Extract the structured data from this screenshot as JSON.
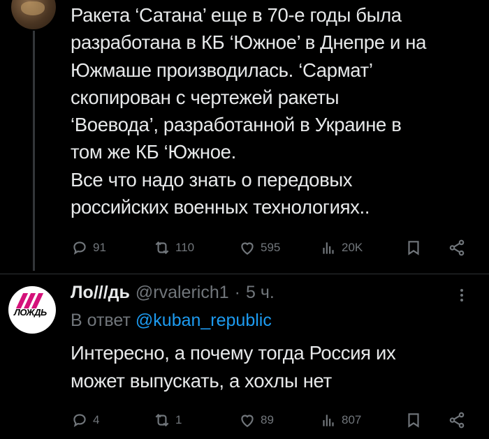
{
  "tweet1": {
    "text": "Ракета ‘Сатана’ еще в 70-е годы была\nразработана в КБ ‘Южное’ в Днепре и на\nЮжмаше производилась. ‘Сармат’\nскопирован с чертежей ракеты\n‘Воевода’, разработанной в Украине в\nтом же КБ ‘Южное.\nВсе что надо знать о передовых\nроссийских военных технологиях..",
    "replies": "91",
    "retweets": "110",
    "likes": "595",
    "views": "20K"
  },
  "tweet2": {
    "avatar_text": "ЛОЖДЬ",
    "name": "Ло///дь",
    "handle": "@rvalerich1",
    "sep": "·",
    "time": "5 ч.",
    "reply_prefix": "В ответ",
    "reply_to": "@kuban_republic",
    "text": "Интересно, а почему тогда Россия их\nможет выпускать, а хохлы нет",
    "replies": "4",
    "retweets": "1",
    "likes": "89",
    "views": "807"
  },
  "colors": {
    "background": "#000000",
    "text": "#e7e9ea",
    "secondary": "#71767b",
    "link": "#1d9bf0",
    "brand_pink": "#d4127a"
  },
  "icons": [
    "reply-icon",
    "retweet-icon",
    "like-icon",
    "views-icon",
    "bookmark-icon",
    "share-icon",
    "more-icon"
  ]
}
